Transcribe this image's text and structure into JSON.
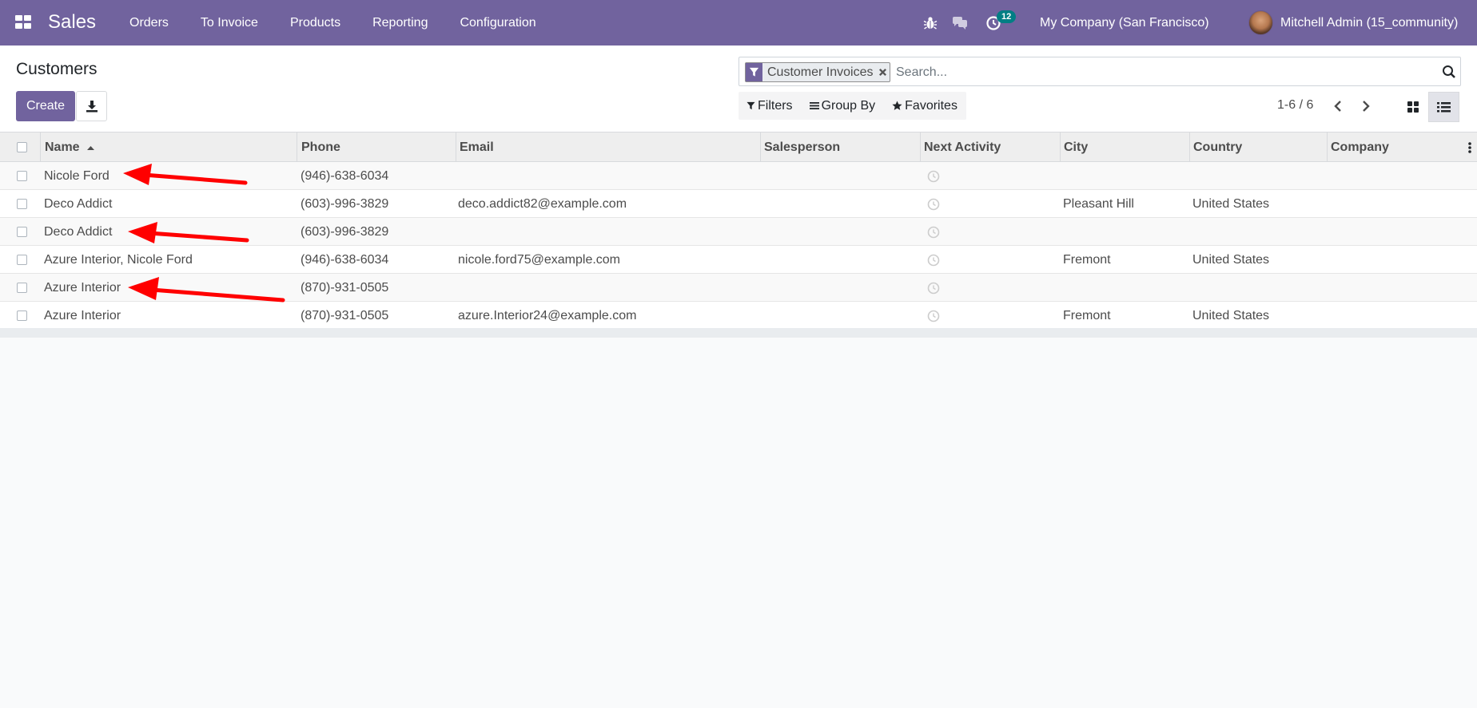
{
  "navbar": {
    "app_name": "Sales",
    "menu": [
      "Orders",
      "To Invoice",
      "Products",
      "Reporting",
      "Configuration"
    ],
    "activity_count": "12",
    "company": "My Company (San Francisco)",
    "user": "Mitchell Admin (15_community)"
  },
  "control": {
    "title": "Customers",
    "create_label": "Create",
    "facet_label": "Customer Invoices",
    "search_placeholder": "Search...",
    "filters_label": "Filters",
    "groupby_label": "Group By",
    "favorites_label": "Favorites",
    "pager": "1-6 / 6"
  },
  "table": {
    "columns": [
      "Name",
      "Phone",
      "Email",
      "Salesperson",
      "Next Activity",
      "City",
      "Country",
      "Company"
    ],
    "rows": [
      {
        "name": "Nicole Ford",
        "phone": "(946)-638-6034",
        "email": "",
        "salesperson": "",
        "city": "",
        "country": "",
        "company": ""
      },
      {
        "name": "Deco Addict",
        "phone": "(603)-996-3829",
        "email": "deco.addict82@example.com",
        "salesperson": "",
        "city": "Pleasant Hill",
        "country": "United States",
        "company": ""
      },
      {
        "name": "Deco Addict",
        "phone": "(603)-996-3829",
        "email": "",
        "salesperson": "",
        "city": "",
        "country": "",
        "company": ""
      },
      {
        "name": "Azure Interior, Nicole Ford",
        "phone": "(946)-638-6034",
        "email": "nicole.ford75@example.com",
        "salesperson": "",
        "city": "Fremont",
        "country": "United States",
        "company": ""
      },
      {
        "name": "Azure Interior",
        "phone": "(870)-931-0505",
        "email": "",
        "salesperson": "",
        "city": "",
        "country": "",
        "company": ""
      },
      {
        "name": "Azure Interior",
        "phone": "(870)-931-0505",
        "email": "azure.Interior24@example.com",
        "salesperson": "",
        "city": "Fremont",
        "country": "United States",
        "company": ""
      }
    ]
  },
  "colors": {
    "brand": "#71639e",
    "badge": "#017e84",
    "annotation": "#ff0000"
  },
  "icons": [
    "apps-icon",
    "bug-icon",
    "chat-icon",
    "activity-clock-icon",
    "download-icon",
    "filter-icon",
    "close-icon",
    "search-icon",
    "group-by-icon",
    "star-icon",
    "chevron-left-icon",
    "chevron-right-icon",
    "kanban-view-icon",
    "list-view-icon",
    "sort-asc-icon",
    "column-options-icon"
  ]
}
